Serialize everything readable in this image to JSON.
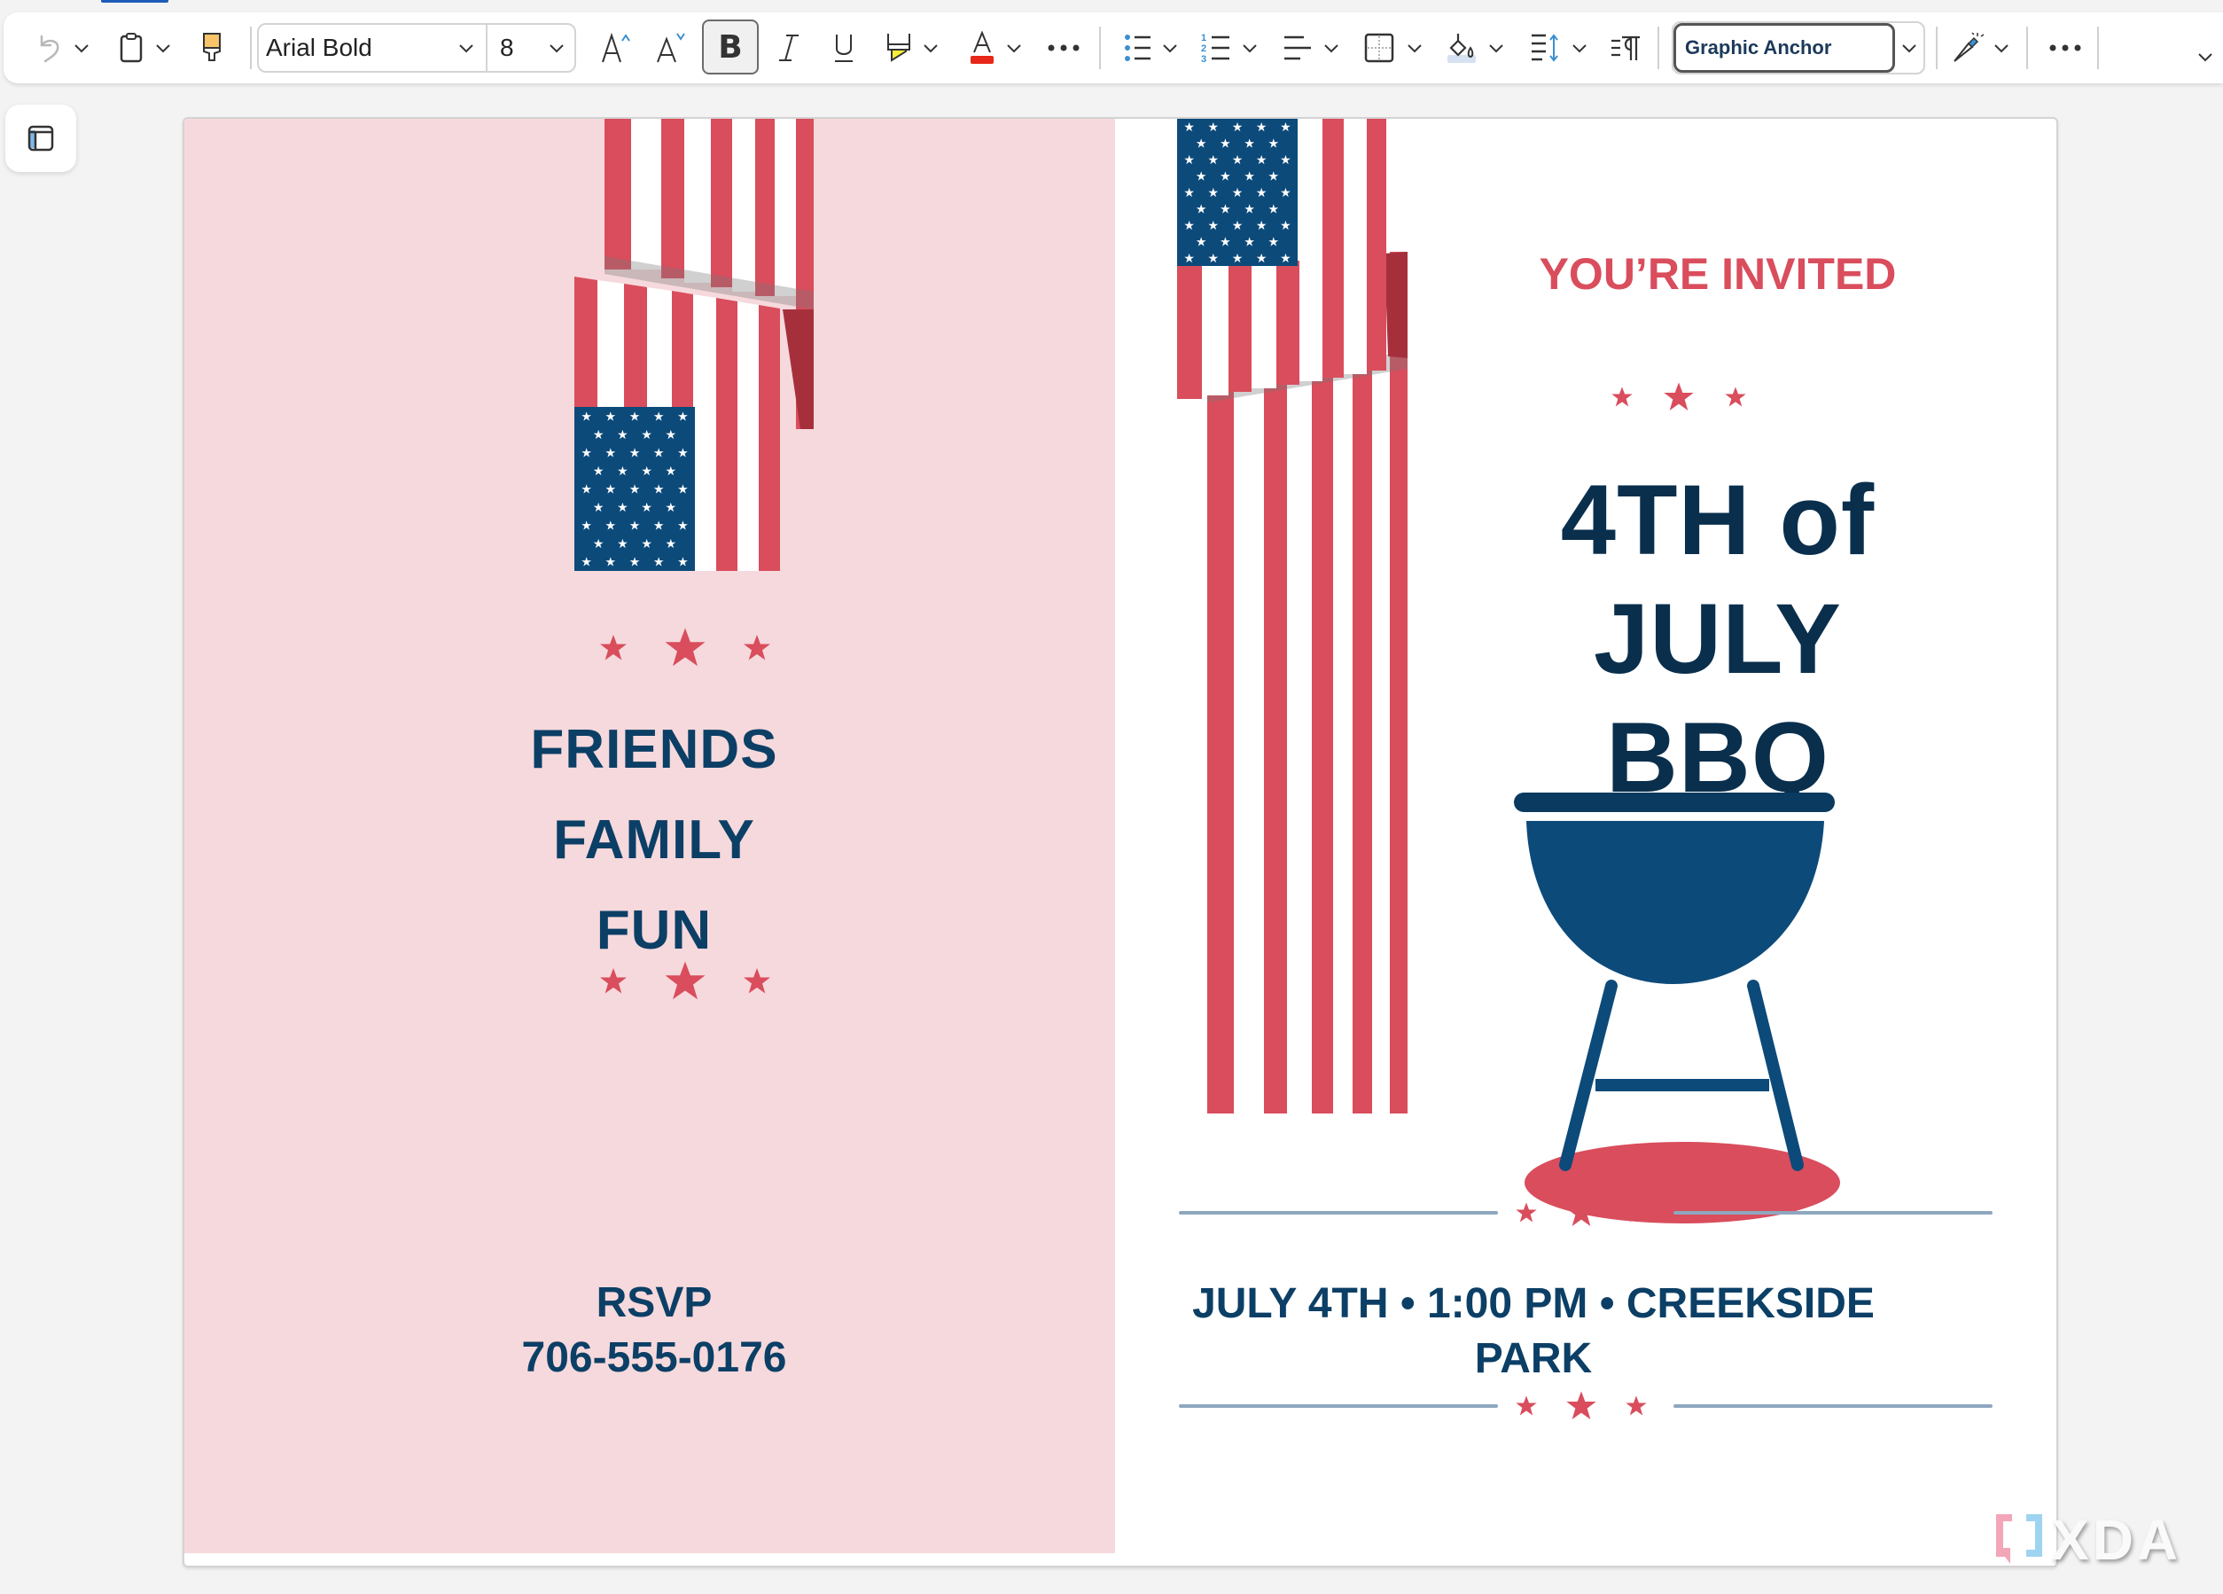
{
  "toolbar": {
    "font_name": "Arial Bold",
    "font_size": "8",
    "bold_label": "B",
    "style_name": "Graphic Anchor",
    "icons": [
      "undo-icon",
      "clipboard-icon",
      "format-painter-icon",
      "grow-font-icon",
      "shrink-font-icon",
      "bold-icon",
      "italic-icon",
      "underline-icon",
      "highlight-icon",
      "font-color-icon",
      "more-icon",
      "bullets-icon",
      "numbering-icon",
      "align-icon",
      "borders-icon",
      "shading-icon",
      "line-spacing-icon",
      "paragraph-mark-icon",
      "designer-icon",
      "more-options-icon"
    ],
    "colors": {
      "font_color": "#e8261a",
      "highlight_color": "#f6ef3a",
      "accent": "#1f5bb8"
    }
  },
  "sidebar": {
    "button": "layout-pane-icon"
  },
  "flyer": {
    "left": {
      "lines": [
        "FRIENDS",
        "FAMILY",
        "FUN"
      ],
      "rsvp_label": "RSVP",
      "phone": "706-555-0176",
      "background": "#f6d9dc"
    },
    "right": {
      "invite": "YOU’RE INVITED",
      "title_lines": [
        "4TH of",
        "JULY",
        "BBQ"
      ],
      "details_line1": "JULY 4TH • 1:00 PM • CREEKSIDE",
      "details_line2": "PARK"
    },
    "colors": {
      "navy": "#0c3f66",
      "red": "#d94d5c",
      "rule": "#8ea7bf"
    }
  },
  "watermark": {
    "text": "XDA"
  }
}
